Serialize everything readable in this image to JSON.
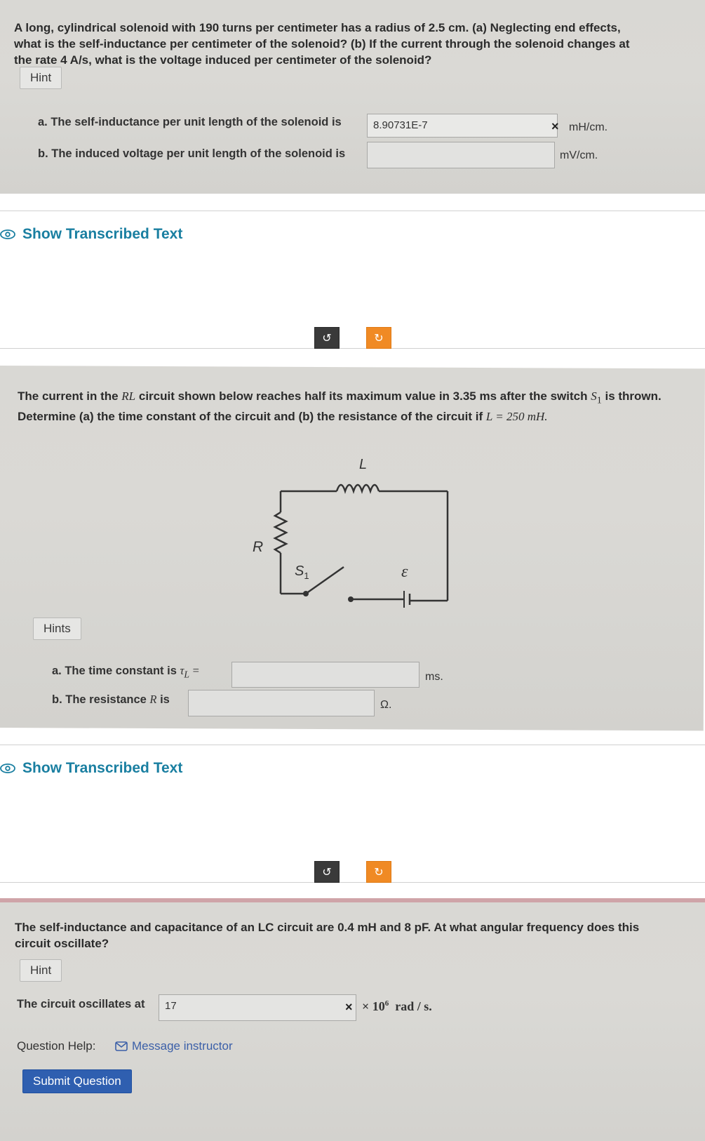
{
  "q1": {
    "text": "A long, cylindrical solenoid with 190 turns per centimeter has a radius of 2.5 cm. (a) Neglecting end effects, what is the self-inductance per centimeter of the solenoid? (b) If the current through the solenoid changes at the rate 4 A/s, what is the voltage induced per centimeter of the solenoid?",
    "hint_label": "Hint",
    "a_label": "a. The self-inductance per unit length of the solenoid is",
    "a_value": "8.90731E-7",
    "a_unit": "mH/cm.",
    "a_status": "×",
    "b_label": "b. The induced voltage per unit length of the solenoid is",
    "b_value": "",
    "b_unit": "mV/cm."
  },
  "transcribed_1": {
    "label": "Show Transcribed Text"
  },
  "toolbar_1": {
    "undo": "↺",
    "redo": "↻"
  },
  "q2": {
    "text_1": "The current in the ",
    "rl": "RL",
    "text_2": " circuit shown below reaches half its maximum value in 3.35 ms after the switch ",
    "s1": "S",
    "s1_sub": "1",
    "text_3": " is thrown. Determine (a) the time constant of the circuit and (b) the resistance of the circuit if ",
    "l_eq": "L = 250  mH.",
    "circuit": {
      "L": "L",
      "R": "R",
      "S": "S",
      "S_sub": "1",
      "E": "ε"
    },
    "hints_label": "Hints",
    "a_label": "a. The time constant is",
    "a_symbol": "τ",
    "a_sub": "L",
    "a_eq": "=",
    "a_value": "",
    "a_unit": "ms.",
    "b_label": "b. The resistance",
    "b_symbol": "R",
    "b_is": "is",
    "b_value": "",
    "b_unit": "Ω."
  },
  "transcribed_2": {
    "label": "Show Transcribed Text"
  },
  "toolbar_2": {
    "undo": "↺",
    "redo": "↻"
  },
  "q3": {
    "text": "The self-inductance and capacitance of an LC circuit are 0.4 mH and 8 pF. At what angular frequency does this circuit oscillate?",
    "hint_label": "Hint",
    "answer_label": "The circuit oscillates at",
    "answer_value": "17",
    "answer_status": "×",
    "unit_times": "× 10",
    "unit_exp": "6",
    "unit_rest": "rad / s.",
    "help_label": "Question Help:",
    "message_label": "Message instructor",
    "submit_label": "Submit Question"
  }
}
